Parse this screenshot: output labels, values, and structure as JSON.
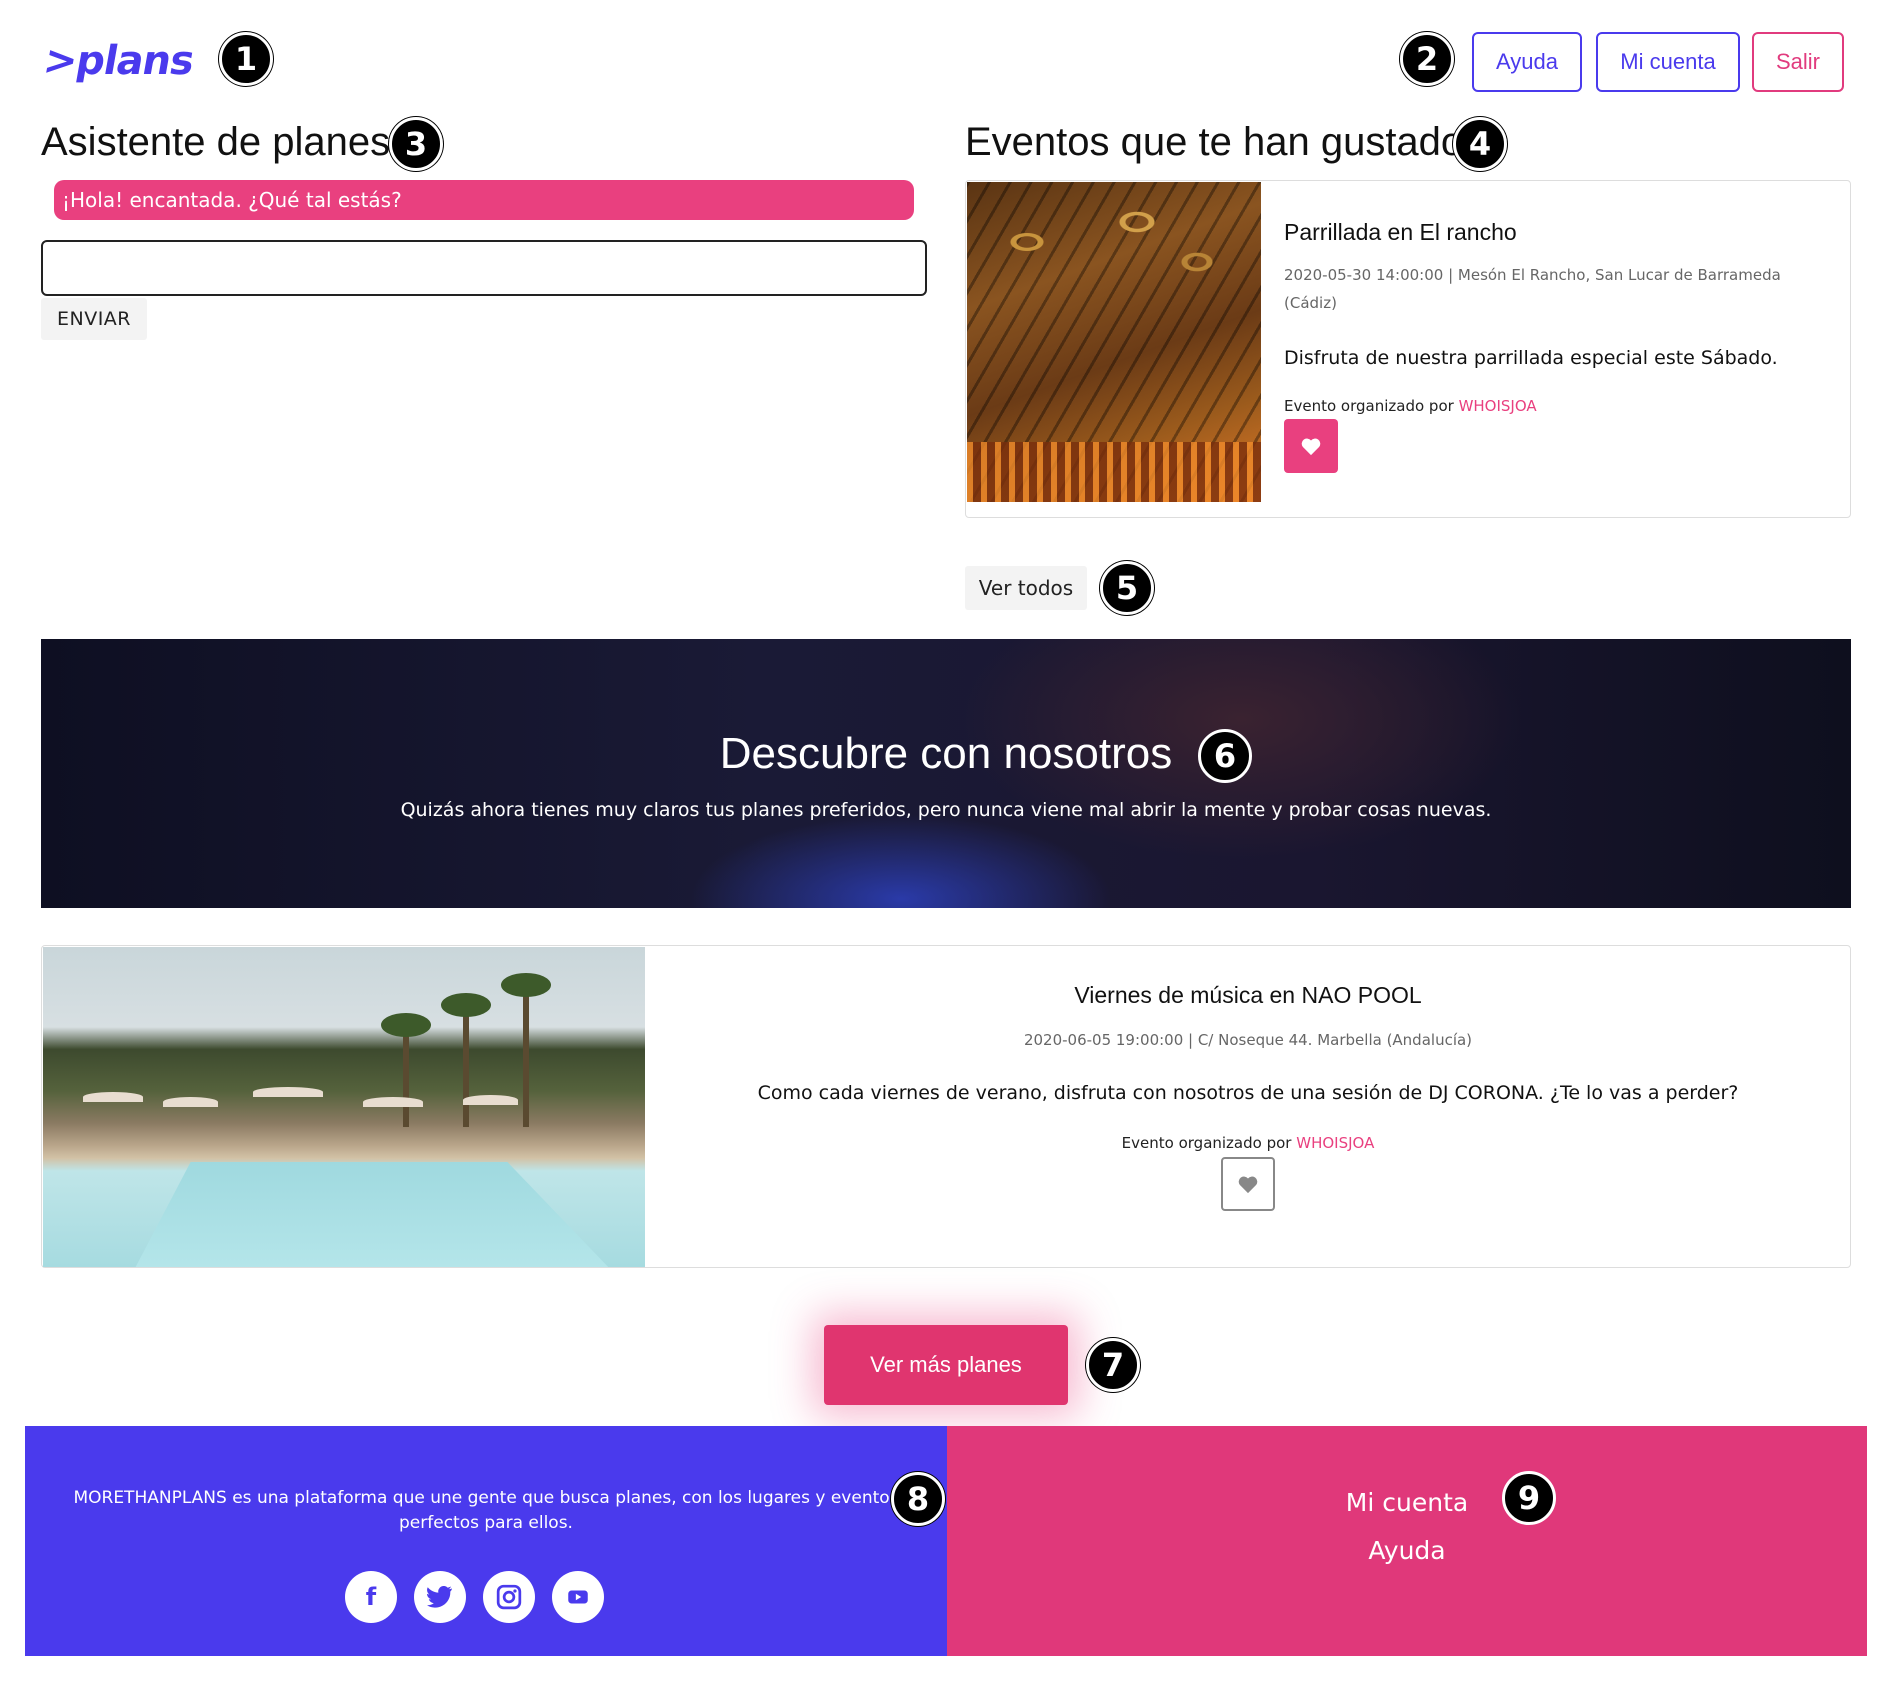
{
  "header": {
    "logo": ">plans",
    "buttons": {
      "help": "Ayuda",
      "account": "Mi cuenta",
      "logout": "Salir"
    }
  },
  "markers": [
    "1",
    "2",
    "3",
    "4",
    "5",
    "6",
    "7",
    "8",
    "9"
  ],
  "assistant": {
    "title": "Asistente de planes",
    "message": "¡Hola! encantada. ¿Qué tal estás?",
    "input_value": "",
    "send_label": "ENVIAR"
  },
  "liked": {
    "title": "Eventos que te han gustado",
    "event": {
      "title": "Parrillada en El rancho",
      "meta_line1": "2020-05-30 14:00:00 | Mesón El Rancho, San Lucar de Barrameda",
      "meta_line2": "(Cádiz)",
      "description": "Disfruta de nuestra parrillada especial este Sábado.",
      "organized_by": "Evento organizado por ",
      "organizer": "WHOISJOA"
    },
    "see_all": "Ver todos"
  },
  "hero": {
    "title": "Descubre con nosotros",
    "subtitle": "Quizás ahora tienes muy claros tus planes preferidos, pero nunca viene mal abrir la mente y probar cosas nuevas."
  },
  "featured": {
    "title": "Viernes de música en NAO POOL",
    "meta": "2020-06-05 19:00:00 | C/ Noseque 44. Marbella (Andalucía)",
    "description": "Como cada viernes de verano, disfruta con nosotros de una sesión de DJ CORONA. ¿Te lo vas a perder?",
    "organized_by": "Evento organizado por ",
    "organizer": "WHOISJOA"
  },
  "more_button": "Ver más planes",
  "footer": {
    "about": "MORETHANPLANS es una plataforma que une gente que busca planes, con los lugares y eventos perfectos para ellos.",
    "social_icons": [
      "facebook-icon",
      "twitter-icon",
      "instagram-icon",
      "youtube-icon"
    ],
    "links": {
      "account": "Mi cuenta",
      "help": "Ayuda"
    }
  },
  "colors": {
    "brand_blue": "#4a3aed",
    "brand_pink": "#e9407f"
  }
}
